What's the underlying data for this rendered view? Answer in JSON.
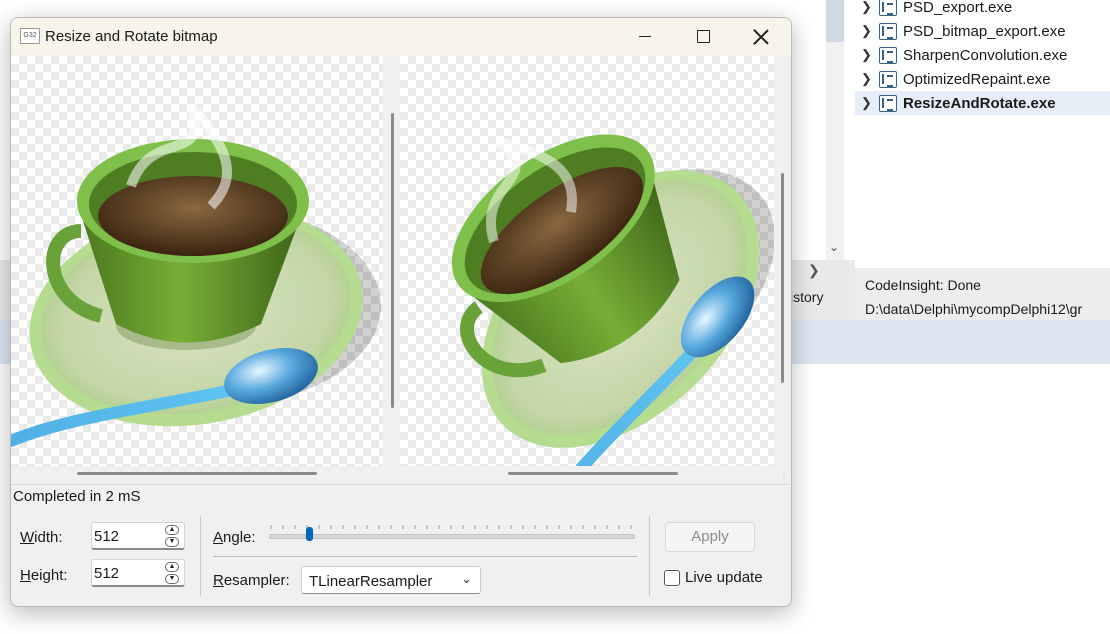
{
  "ide": {
    "tree_items": [
      {
        "label": "PSD_export.exe",
        "selected": false
      },
      {
        "label": "PSD_bitmap_export.exe",
        "selected": false
      },
      {
        "label": "SharpenConvolution.exe",
        "selected": false
      },
      {
        "label": "OptimizedRepaint.exe",
        "selected": false
      },
      {
        "label": "ResizeAndRotate.exe",
        "selected": true
      }
    ],
    "side_tab_label": "istory",
    "status_line1": "CodeInsight: Done",
    "status_line2": "D:\\data\\Delphi\\mycompDelphi12\\gr"
  },
  "dialog": {
    "title": "Resize and Rotate bitmap",
    "app_icon_text": "G32",
    "status_text": "Completed in 2 mS",
    "width": {
      "label_first": "W",
      "label_rest": "idth:",
      "value": "512"
    },
    "height": {
      "label_first": "H",
      "label_rest": "eight:",
      "value": "512"
    },
    "angle": {
      "label_first": "A",
      "label_rest": "ngle:",
      "value_fraction": 0.11
    },
    "resampler": {
      "label_first": "R",
      "label_rest": "esampler:",
      "value": "TLinearResampler"
    },
    "apply_label": "Apply",
    "live_update_label": "Live update",
    "live_update_checked": false
  }
}
